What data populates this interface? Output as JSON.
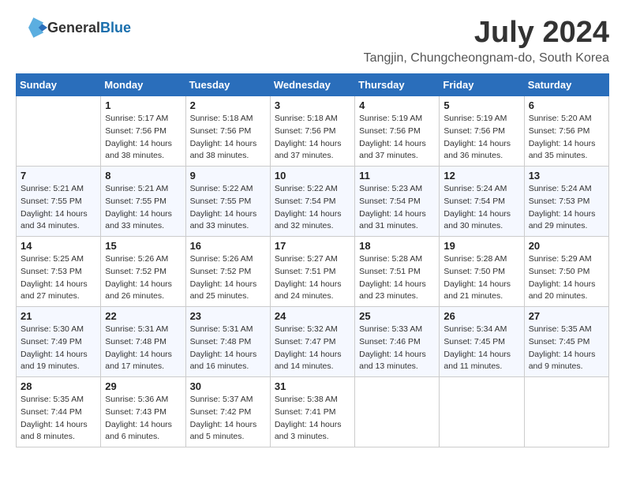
{
  "logo": {
    "general": "General",
    "blue": "Blue"
  },
  "title": {
    "month_year": "July 2024",
    "location": "Tangjin, Chungcheongnam-do, South Korea"
  },
  "headers": [
    "Sunday",
    "Monday",
    "Tuesday",
    "Wednesday",
    "Thursday",
    "Friday",
    "Saturday"
  ],
  "weeks": [
    [
      {
        "day": "",
        "info": ""
      },
      {
        "day": "1",
        "info": "Sunrise: 5:17 AM\nSunset: 7:56 PM\nDaylight: 14 hours\nand 38 minutes."
      },
      {
        "day": "2",
        "info": "Sunrise: 5:18 AM\nSunset: 7:56 PM\nDaylight: 14 hours\nand 38 minutes."
      },
      {
        "day": "3",
        "info": "Sunrise: 5:18 AM\nSunset: 7:56 PM\nDaylight: 14 hours\nand 37 minutes."
      },
      {
        "day": "4",
        "info": "Sunrise: 5:19 AM\nSunset: 7:56 PM\nDaylight: 14 hours\nand 37 minutes."
      },
      {
        "day": "5",
        "info": "Sunrise: 5:19 AM\nSunset: 7:56 PM\nDaylight: 14 hours\nand 36 minutes."
      },
      {
        "day": "6",
        "info": "Sunrise: 5:20 AM\nSunset: 7:56 PM\nDaylight: 14 hours\nand 35 minutes."
      }
    ],
    [
      {
        "day": "7",
        "info": "Sunrise: 5:21 AM\nSunset: 7:55 PM\nDaylight: 14 hours\nand 34 minutes."
      },
      {
        "day": "8",
        "info": "Sunrise: 5:21 AM\nSunset: 7:55 PM\nDaylight: 14 hours\nand 33 minutes."
      },
      {
        "day": "9",
        "info": "Sunrise: 5:22 AM\nSunset: 7:55 PM\nDaylight: 14 hours\nand 33 minutes."
      },
      {
        "day": "10",
        "info": "Sunrise: 5:22 AM\nSunset: 7:54 PM\nDaylight: 14 hours\nand 32 minutes."
      },
      {
        "day": "11",
        "info": "Sunrise: 5:23 AM\nSunset: 7:54 PM\nDaylight: 14 hours\nand 31 minutes."
      },
      {
        "day": "12",
        "info": "Sunrise: 5:24 AM\nSunset: 7:54 PM\nDaylight: 14 hours\nand 30 minutes."
      },
      {
        "day": "13",
        "info": "Sunrise: 5:24 AM\nSunset: 7:53 PM\nDaylight: 14 hours\nand 29 minutes."
      }
    ],
    [
      {
        "day": "14",
        "info": "Sunrise: 5:25 AM\nSunset: 7:53 PM\nDaylight: 14 hours\nand 27 minutes."
      },
      {
        "day": "15",
        "info": "Sunrise: 5:26 AM\nSunset: 7:52 PM\nDaylight: 14 hours\nand 26 minutes."
      },
      {
        "day": "16",
        "info": "Sunrise: 5:26 AM\nSunset: 7:52 PM\nDaylight: 14 hours\nand 25 minutes."
      },
      {
        "day": "17",
        "info": "Sunrise: 5:27 AM\nSunset: 7:51 PM\nDaylight: 14 hours\nand 24 minutes."
      },
      {
        "day": "18",
        "info": "Sunrise: 5:28 AM\nSunset: 7:51 PM\nDaylight: 14 hours\nand 23 minutes."
      },
      {
        "day": "19",
        "info": "Sunrise: 5:28 AM\nSunset: 7:50 PM\nDaylight: 14 hours\nand 21 minutes."
      },
      {
        "day": "20",
        "info": "Sunrise: 5:29 AM\nSunset: 7:50 PM\nDaylight: 14 hours\nand 20 minutes."
      }
    ],
    [
      {
        "day": "21",
        "info": "Sunrise: 5:30 AM\nSunset: 7:49 PM\nDaylight: 14 hours\nand 19 minutes."
      },
      {
        "day": "22",
        "info": "Sunrise: 5:31 AM\nSunset: 7:48 PM\nDaylight: 14 hours\nand 17 minutes."
      },
      {
        "day": "23",
        "info": "Sunrise: 5:31 AM\nSunset: 7:48 PM\nDaylight: 14 hours\nand 16 minutes."
      },
      {
        "day": "24",
        "info": "Sunrise: 5:32 AM\nSunset: 7:47 PM\nDaylight: 14 hours\nand 14 minutes."
      },
      {
        "day": "25",
        "info": "Sunrise: 5:33 AM\nSunset: 7:46 PM\nDaylight: 14 hours\nand 13 minutes."
      },
      {
        "day": "26",
        "info": "Sunrise: 5:34 AM\nSunset: 7:45 PM\nDaylight: 14 hours\nand 11 minutes."
      },
      {
        "day": "27",
        "info": "Sunrise: 5:35 AM\nSunset: 7:45 PM\nDaylight: 14 hours\nand 9 minutes."
      }
    ],
    [
      {
        "day": "28",
        "info": "Sunrise: 5:35 AM\nSunset: 7:44 PM\nDaylight: 14 hours\nand 8 minutes."
      },
      {
        "day": "29",
        "info": "Sunrise: 5:36 AM\nSunset: 7:43 PM\nDaylight: 14 hours\nand 6 minutes."
      },
      {
        "day": "30",
        "info": "Sunrise: 5:37 AM\nSunset: 7:42 PM\nDaylight: 14 hours\nand 5 minutes."
      },
      {
        "day": "31",
        "info": "Sunrise: 5:38 AM\nSunset: 7:41 PM\nDaylight: 14 hours\nand 3 minutes."
      },
      {
        "day": "",
        "info": ""
      },
      {
        "day": "",
        "info": ""
      },
      {
        "day": "",
        "info": ""
      }
    ]
  ]
}
